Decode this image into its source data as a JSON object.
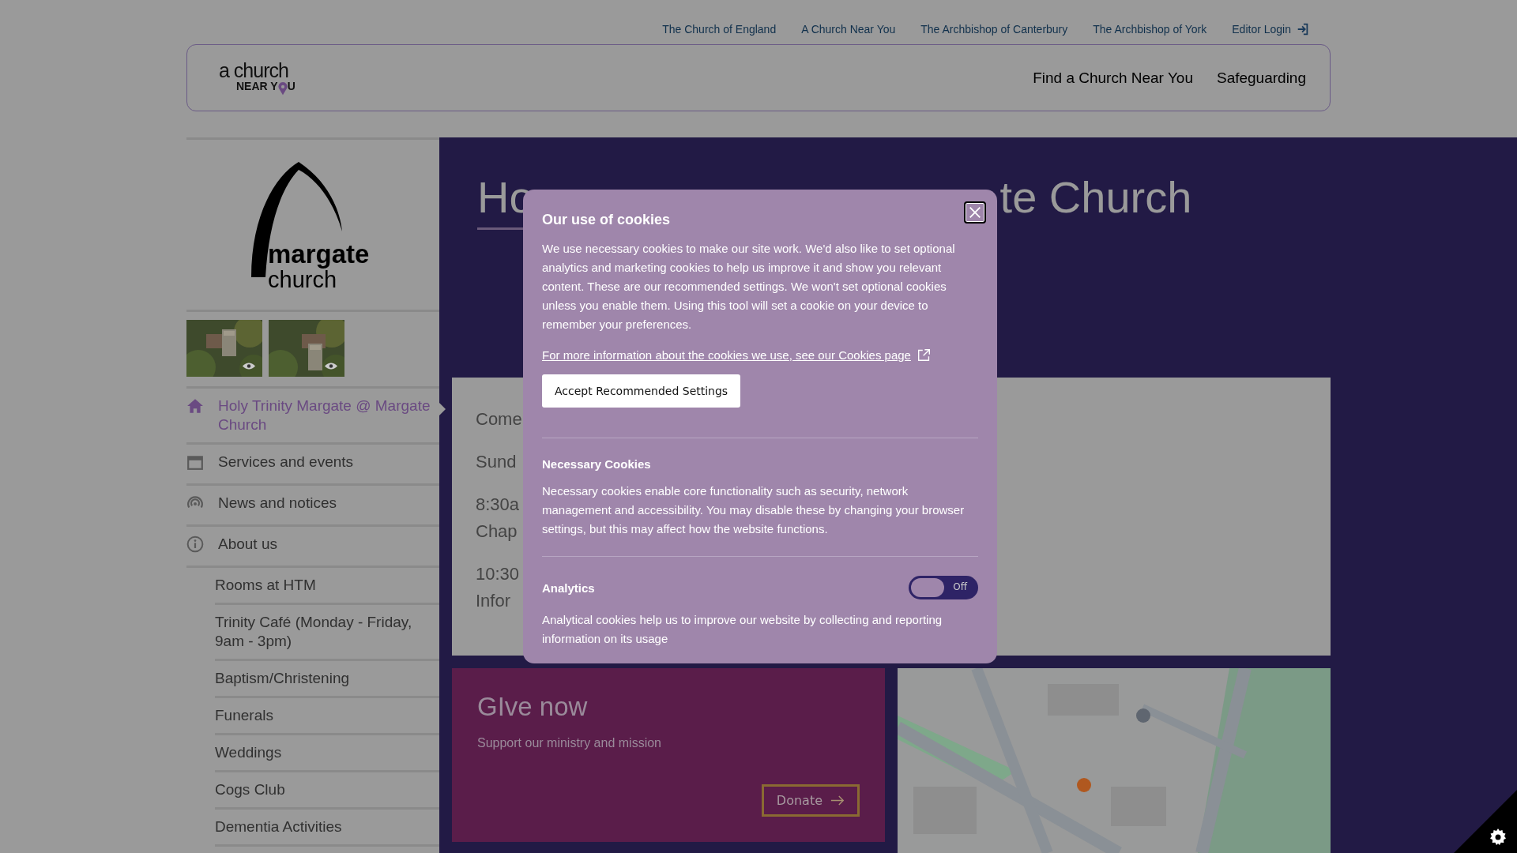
{
  "top_links": [
    "The Church of England",
    "A Church Near You",
    "The Archbishop of Canterbury",
    "The Archbishop of York",
    "Editor Login"
  ],
  "header": {
    "logo_top": "a church",
    "logo_bottom": "NEAR Y",
    "logo_end": "U",
    "nav": [
      "Find a Church Near You",
      "Safeguarding"
    ]
  },
  "sidebar": {
    "logo_top": "margate",
    "logo_bottom": "church",
    "gallery": [
      {
        "kind": "picture"
      },
      {
        "kind": "picture"
      }
    ],
    "items": [
      {
        "label": "Holy Trinity Margate @ Margate Church",
        "selected": true
      },
      {
        "label": "Services and events",
        "selected": false
      },
      {
        "label": "News and notices",
        "selected": false
      },
      {
        "label": "About us",
        "selected": false,
        "children": [
          {
            "label": "Rooms at HTM"
          },
          {
            "label": "Trinity Café (Monday - Friday, 9am - 3pm)"
          },
          {
            "label": "Baptism/Christening"
          },
          {
            "label": "Funerals"
          },
          {
            "label": "Weddings"
          },
          {
            "label": "Cogs Club"
          },
          {
            "label": "Dementia Activities"
          }
        ]
      }
    ]
  },
  "hero": {
    "title_parts": [
      "Ho",
      "te Church"
    ]
  },
  "content": {
    "lines": [
      "Come",
      "Sund",
      "8:30a",
      "Chap",
      "10:30",
      "Infor"
    ]
  },
  "give": {
    "title": "GIve now",
    "text": "Support our ministry and mission",
    "button": "Donate"
  },
  "map": {
    "kind": "picture"
  },
  "cookie_dialog": {
    "title": "Our use of cookies",
    "intro": "We use necessary cookies to make our site work. We'd also like to set optional analytics and marketing cookies to help us improve it and show you relevant content. These are our recommended settings. We won't set optional cookies unless you enable them. Using this tool will set a cookie on your device to remember your preferences.",
    "link": "For more information about the cookies we use, see our Cookies page",
    "accept_button": "Accept Recommended Settings",
    "sections": [
      {
        "title": "Necessary Cookies",
        "text": "Necessary cookies enable core functionality such as security, network management and accessibility. You may disable these by changing your browser settings, but this may affect how the website functions."
      },
      {
        "title": "Analytics",
        "toggle": {
          "on": false,
          "label": "Off"
        },
        "text": "Analytical cookies help us to improve our website by collecting and reporting information on its usage"
      }
    ]
  }
}
